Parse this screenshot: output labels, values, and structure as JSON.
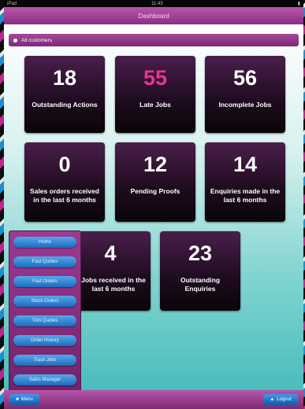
{
  "status": {
    "left": "iPad",
    "time": "11:43"
  },
  "title": "Dashboard",
  "filter": {
    "label": "All customers"
  },
  "cards": [
    {
      "value": "18",
      "label": "Outstanding Actions"
    },
    {
      "value": "55",
      "label": "Late Jobs"
    },
    {
      "value": "56",
      "label": "Incomplete Jobs"
    },
    {
      "value": "0",
      "label": "Sales orders received in the last 6 months"
    },
    {
      "value": "12",
      "label": "Pending Proofs"
    },
    {
      "value": "14",
      "label": "Enquiries made in the last 6 months"
    },
    {
      "value": "4",
      "label": "Jobs received in the last 6 months"
    },
    {
      "value": "23",
      "label": "Outstanding Enquiries"
    }
  ],
  "menu": [
    "Home",
    "Fast Quotes",
    "Fast Orders",
    "Stock Orders",
    "Trim Quotes",
    "Order History",
    "Track Jobs",
    "Sales Manager"
  ],
  "bottom": {
    "left": "Menu",
    "right": "Logout"
  },
  "colors": {
    "accent": "#8b2f83",
    "highlight": "#e8348f",
    "button": "#1d6cc2"
  }
}
